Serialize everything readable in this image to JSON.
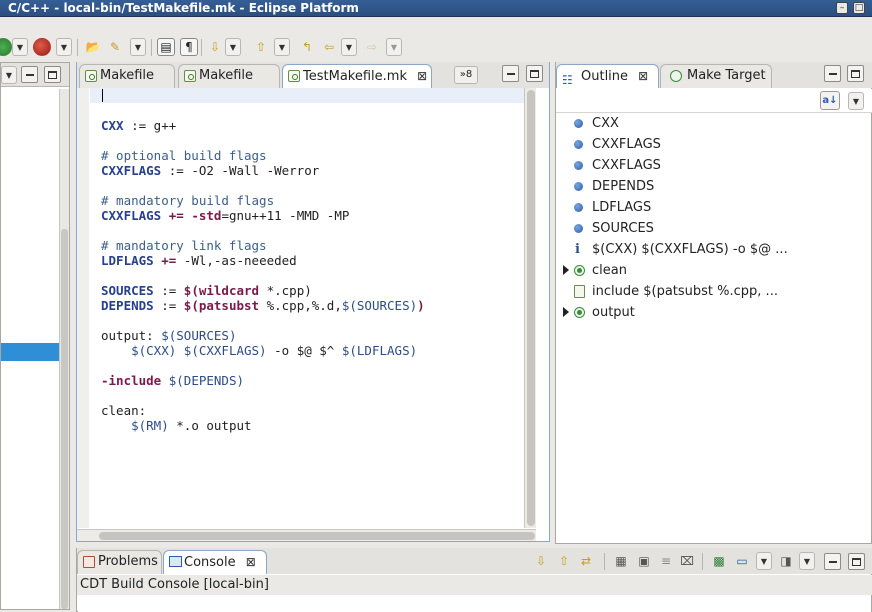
{
  "window": {
    "title": "C/C++ - local-bin/TestMakefile.mk - Eclipse Platform"
  },
  "editor": {
    "tabs": [
      {
        "label": "Makefile"
      },
      {
        "label": "Makefile"
      },
      {
        "label": "TestMakefile.mk"
      }
    ],
    "overflow_count": "»8",
    "close_glyph": "⊠"
  },
  "code": [
    [],
    [],
    [
      [
        "var",
        "CXX"
      ],
      [
        "t",
        " := g++"
      ]
    ],
    [],
    [
      [
        "cm",
        "# optional build flags"
      ]
    ],
    [
      [
        "var",
        "CXXFLAGS"
      ],
      [
        "t",
        " := -O2 -Wall -Werror"
      ]
    ],
    [],
    [
      [
        "cm",
        "# mandatory build flags"
      ]
    ],
    [
      [
        "var",
        "CXXFLAGS"
      ],
      [
        "t",
        " "
      ],
      [
        "kw",
        "+="
      ],
      [
        "t",
        " "
      ],
      [
        "kw",
        "-std"
      ],
      [
        "t",
        "=gnu++11 -MMD -MP"
      ]
    ],
    [],
    [
      [
        "cm",
        "# mandatory link flags"
      ]
    ],
    [
      [
        "var",
        "LDFLAGS"
      ],
      [
        "t",
        " "
      ],
      [
        "kw",
        "+="
      ],
      [
        "t",
        " -Wl,-as-neeeded"
      ]
    ],
    [],
    [
      [
        "var",
        "SOURCES"
      ],
      [
        "t",
        " := "
      ],
      [
        "fn",
        "$(wildcard"
      ],
      [
        "t",
        " *.cpp)"
      ]
    ],
    [
      [
        "var",
        "DEPENDS"
      ],
      [
        "t",
        " := "
      ],
      [
        "fn",
        "$(patsubst"
      ],
      [
        "t",
        " %.cpp,%.d,"
      ],
      [
        "ref",
        "$(SOURCES)"
      ],
      [
        "fn",
        ")"
      ]
    ],
    [],
    [
      [
        "t",
        "output: "
      ],
      [
        "ref",
        "$(SOURCES)"
      ]
    ],
    [
      [
        "t",
        "    "
      ],
      [
        "ref",
        "$(CXX)"
      ],
      [
        "t",
        " "
      ],
      [
        "ref",
        "$(CXXFLAGS)"
      ],
      [
        "t",
        " -o $@ $^ "
      ],
      [
        "ref",
        "$(LDFLAGS)"
      ]
    ],
    [],
    [
      [
        "kw",
        "-include"
      ],
      [
        "t",
        " "
      ],
      [
        "ref",
        "$(DEPENDS)"
      ]
    ],
    [],
    [
      [
        "t",
        "clean:"
      ]
    ],
    [
      [
        "t",
        "    "
      ],
      [
        "ref",
        "$(RM)"
      ],
      [
        "t",
        " *.o output"
      ]
    ]
  ],
  "outline": {
    "tabs": [
      {
        "label": "Outline"
      },
      {
        "label": "Make Target"
      }
    ],
    "items": [
      {
        "label": "CXX",
        "kind": "variable"
      },
      {
        "label": "CXXFLAGS",
        "kind": "variable"
      },
      {
        "label": "CXXFLAGS",
        "kind": "variable"
      },
      {
        "label": "DEPENDS",
        "kind": "variable"
      },
      {
        "label": "LDFLAGS",
        "kind": "variable"
      },
      {
        "label": "SOURCES",
        "kind": "variable"
      },
      {
        "label": "$(CXX) $(CXXFLAGS) -o $@ ...",
        "kind": "info"
      },
      {
        "label": "clean",
        "kind": "target"
      },
      {
        "label": "include $(patsubst %.cpp, ...",
        "kind": "include"
      },
      {
        "label": "output",
        "kind": "target"
      }
    ]
  },
  "bottom": {
    "tabs": [
      {
        "label": "Problems"
      },
      {
        "label": "Console"
      }
    ],
    "console_title": "CDT Build Console [local-bin]"
  },
  "colors": {
    "accent": "#2e8fd6",
    "title": "#2c4f80"
  }
}
